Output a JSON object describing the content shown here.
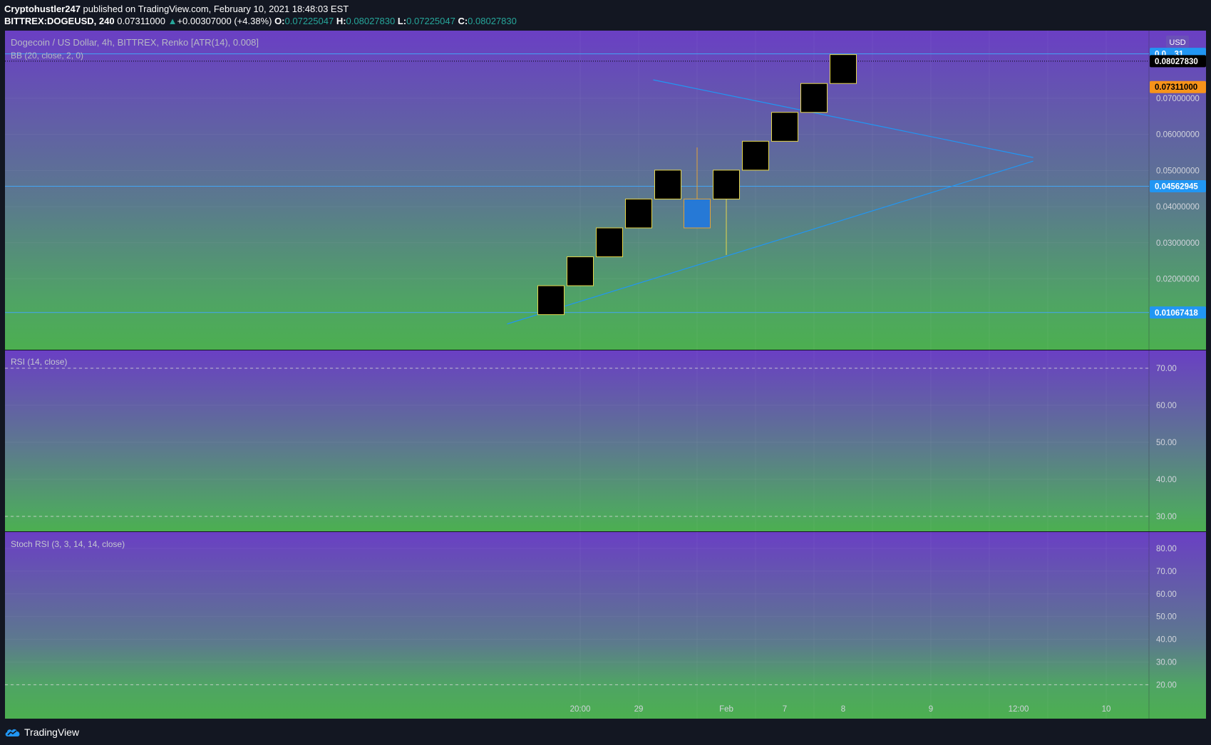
{
  "header": {
    "author": "Cryptohustler247",
    "published_text": "published on TradingView.com, February 10, 2021 18:48:03 EST",
    "symbol": "BITTREX:DOGEUSD, 240",
    "last_price": "0.07311000",
    "change": "+0.00307000 (+4.38%)",
    "change_arrow": "▲",
    "ohlc": [
      {
        "label": "O:",
        "value": "0.07225047"
      },
      {
        "label": "H:",
        "value": "0.08027830"
      },
      {
        "label": "L:",
        "value": "0.07225047"
      },
      {
        "label": "C:",
        "value": "0.08027830"
      }
    ]
  },
  "chart_data": {
    "type": "renko",
    "title": "Dogecoin / US Dollar, 4h, BITTREX, Renko [ATR(14), 0.008]",
    "indicator_label": "BB (20, close, 2, 0)",
    "currency_badge": "USD",
    "price_axis": {
      "ticks": [
        "0.07000000",
        "0.06000000",
        "0.05000000",
        "0.04000000",
        "0.03000000",
        "0.02000000"
      ],
      "tick_values": [
        0.07,
        0.06,
        0.05,
        0.04,
        0.03,
        0.02
      ]
    },
    "price_badges": [
      {
        "text": "0.0…31",
        "value": 0.0823,
        "bg": "#2196f3",
        "fg": "#ffffff",
        "line": true
      },
      {
        "text": "0.08027830",
        "value": 0.0802783,
        "bg": "#000000",
        "fg": "#ffffff",
        "line": false
      },
      {
        "text": "0.07311000",
        "value": 0.07311,
        "bg": "#f7931a",
        "fg": "#000000",
        "line": false
      },
      {
        "text": "0.04562945",
        "value": 0.04562945,
        "bg": "#2196f3",
        "fg": "#ffffff",
        "line": true
      },
      {
        "text": "0.01067418",
        "value": 0.01067418,
        "bg": "#2196f3",
        "fg": "#ffffff",
        "line": true
      }
    ],
    "bricks": [
      {
        "index": 0,
        "low": 0.0101,
        "high": 0.0181,
        "type": "up"
      },
      {
        "index": 1,
        "low": 0.0181,
        "high": 0.0261,
        "type": "up"
      },
      {
        "index": 2,
        "low": 0.0261,
        "high": 0.0341,
        "type": "up"
      },
      {
        "index": 3,
        "low": 0.0341,
        "high": 0.0421,
        "type": "up"
      },
      {
        "index": 4,
        "low": 0.0421,
        "high": 0.0501,
        "type": "up"
      },
      {
        "index": 5,
        "low": 0.0341,
        "high": 0.0421,
        "type": "down",
        "wick_high": 0.0564
      },
      {
        "index": 6,
        "low": 0.0421,
        "high": 0.0501,
        "type": "up",
        "wick_low": 0.0266
      },
      {
        "index": 7,
        "low": 0.0501,
        "high": 0.0581,
        "type": "up"
      },
      {
        "index": 8,
        "low": 0.0581,
        "high": 0.0661,
        "type": "up"
      },
      {
        "index": 9,
        "low": 0.0661,
        "high": 0.0741,
        "type": "up"
      },
      {
        "index": 10,
        "low": 0.0741,
        "high": 0.0821,
        "type": "up"
      }
    ],
    "trendlines": [
      {
        "from": [
          -1.5,
          0.0075
        ],
        "to": [
          16.5,
          0.0526
        ]
      },
      {
        "from": [
          3.5,
          0.0751
        ],
        "to": [
          16.5,
          0.0536
        ]
      }
    ],
    "time_axis": [
      "20:00",
      "29",
      "Feb",
      "7",
      "8",
      "9",
      "12:00",
      "10"
    ],
    "rsi": {
      "label": "RSI (14, close)",
      "ticks": [
        "70.00",
        "60.00",
        "50.00",
        "40.00",
        "30.00"
      ],
      "tick_values": [
        70,
        60,
        50,
        40,
        30
      ],
      "bands": [
        70,
        30
      ]
    },
    "stoch_rsi": {
      "label": "Stoch RSI (3, 3, 14, 14, close)",
      "ticks": [
        "80.00",
        "70.00",
        "60.00",
        "50.00",
        "40.00",
        "30.00",
        "20.00"
      ],
      "tick_values": [
        80,
        70,
        60,
        50,
        40,
        30,
        20
      ],
      "bands": [
        80,
        20
      ]
    },
    "colors": {
      "gradient_top": "#6a3fc4",
      "gradient_bottom": "#4caf50",
      "brick_fill_up": "#000000",
      "brick_border": "#e6d74c",
      "brick_fill_down": "#2679d6",
      "brick_border_down": "#e3a23a",
      "trendline": "#2196f3"
    }
  },
  "footer": {
    "brand": "TradingView",
    "logo_icon": "tradingview-cloud-icon"
  }
}
